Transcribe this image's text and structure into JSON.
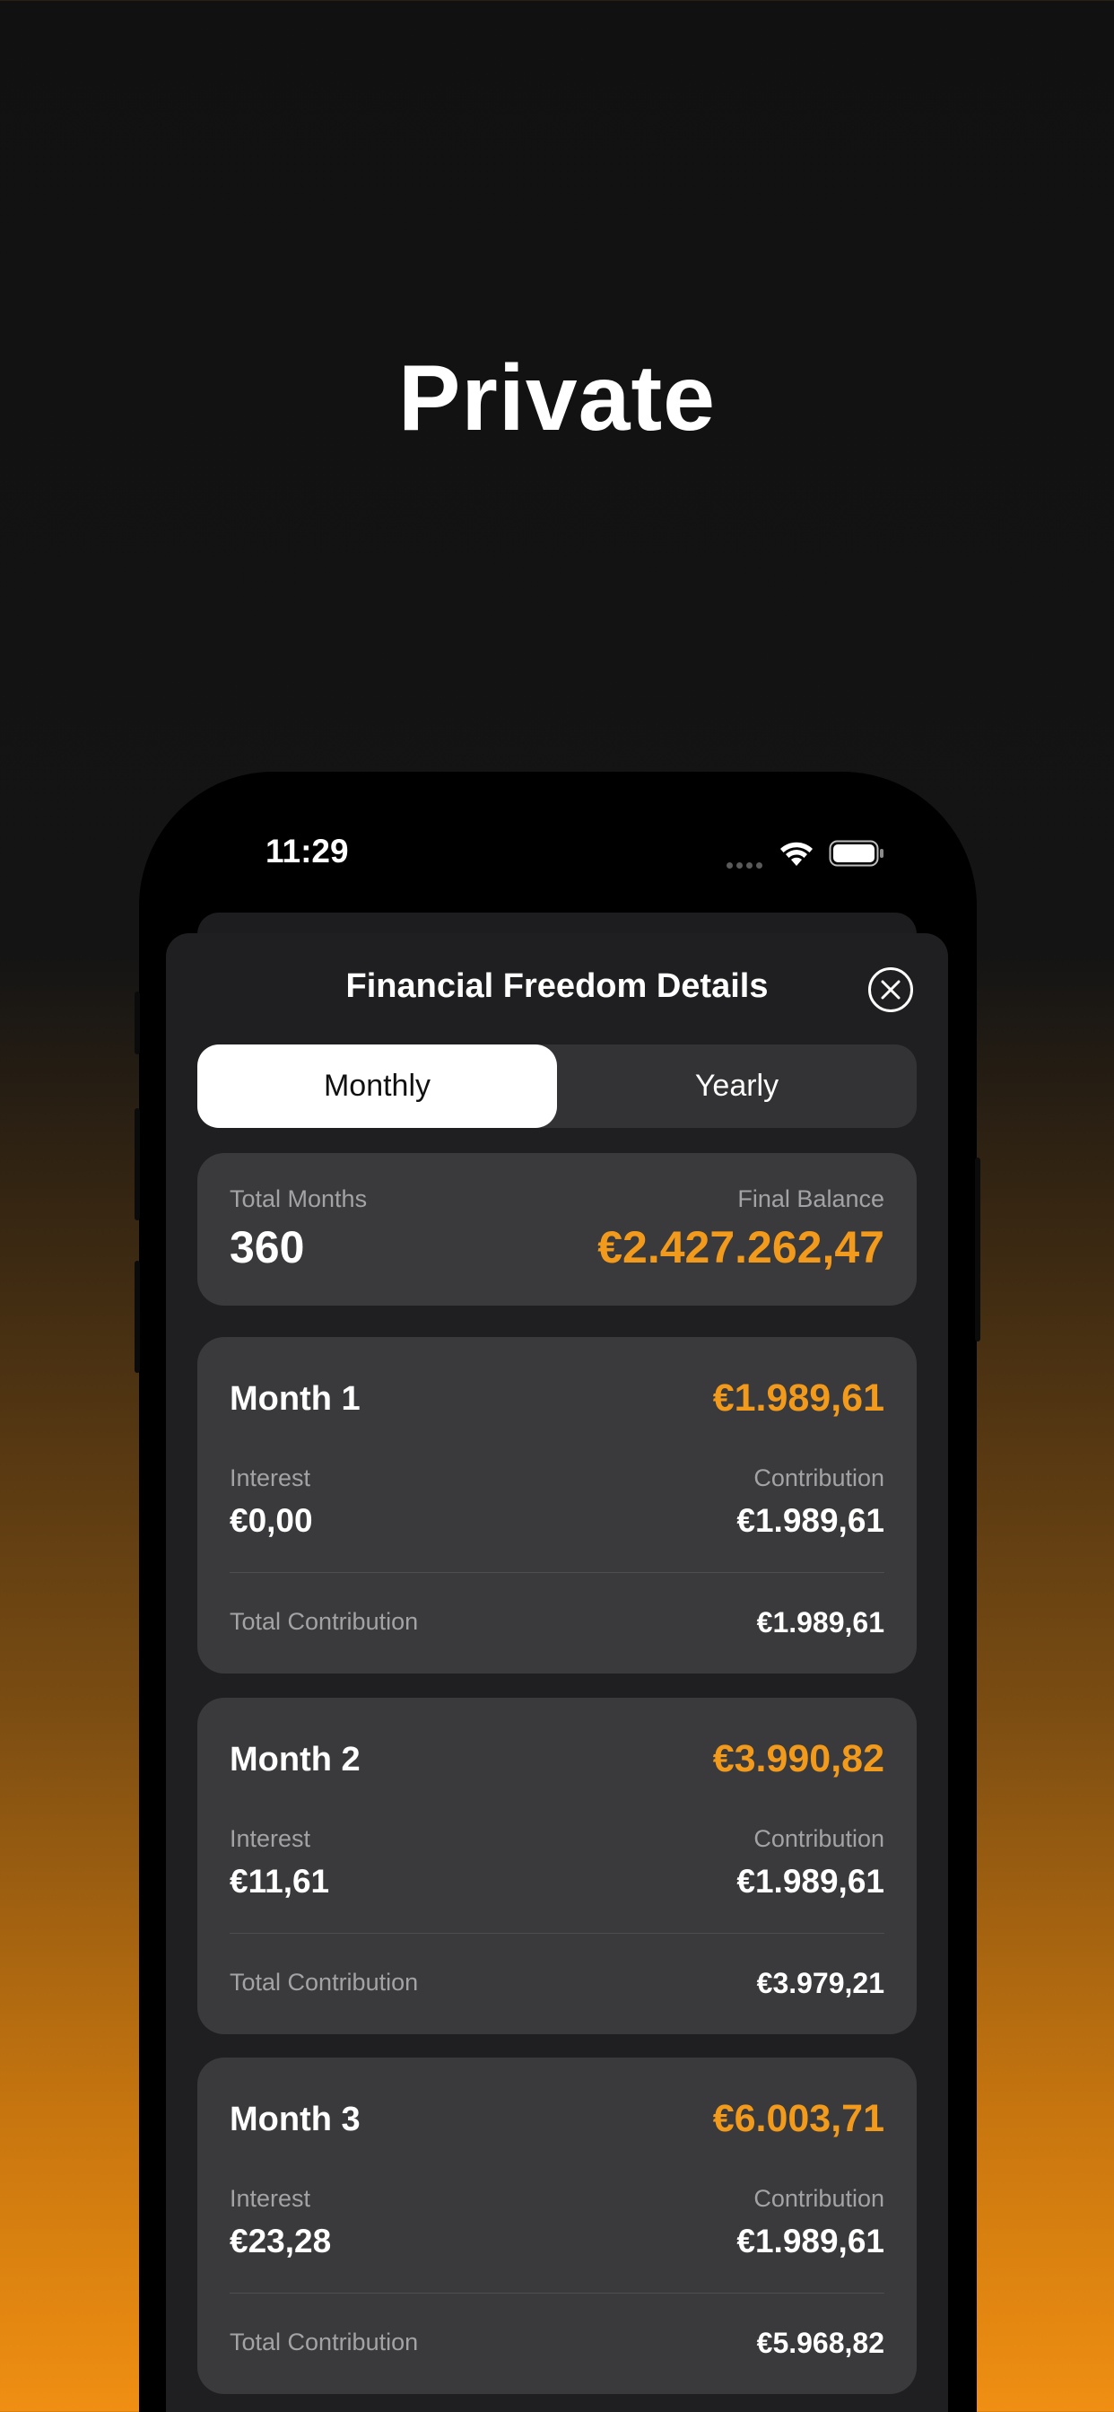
{
  "hero": {
    "title": "Private"
  },
  "status_bar": {
    "time": "11:29"
  },
  "sheet": {
    "title": "Financial Freedom Details",
    "tabs": [
      {
        "label": "Monthly",
        "active": true
      },
      {
        "label": "Yearly",
        "active": false
      }
    ],
    "summary": {
      "months_label": "Total Months",
      "months_value": "360",
      "balance_label": "Final Balance",
      "balance_value": "€2.427.262,47"
    },
    "months": [
      {
        "title": "Month 1",
        "balance": "€1.989,61",
        "interest_label": "Interest",
        "interest": "€0,00",
        "contribution_label": "Contribution",
        "contribution": "€1.989,61",
        "total_label": "Total Contribution",
        "total": "€1.989,61"
      },
      {
        "title": "Month 2",
        "balance": "€3.990,82",
        "interest_label": "Interest",
        "interest": "€11,61",
        "contribution_label": "Contribution",
        "contribution": "€1.989,61",
        "total_label": "Total Contribution",
        "total": "€3.979,21"
      },
      {
        "title": "Month 3",
        "balance": "€6.003,71",
        "interest_label": "Interest",
        "interest": "€23,28",
        "contribution_label": "Contribution",
        "contribution": "€1.989,61",
        "total_label": "Total Contribution",
        "total": "€5.968,82"
      }
    ]
  },
  "colors": {
    "accent": "#f29a1c",
    "card": "#3a393b",
    "sheet": "#1f1f21"
  },
  "icons": [
    "wifi-icon",
    "battery-icon",
    "close-icon"
  ]
}
